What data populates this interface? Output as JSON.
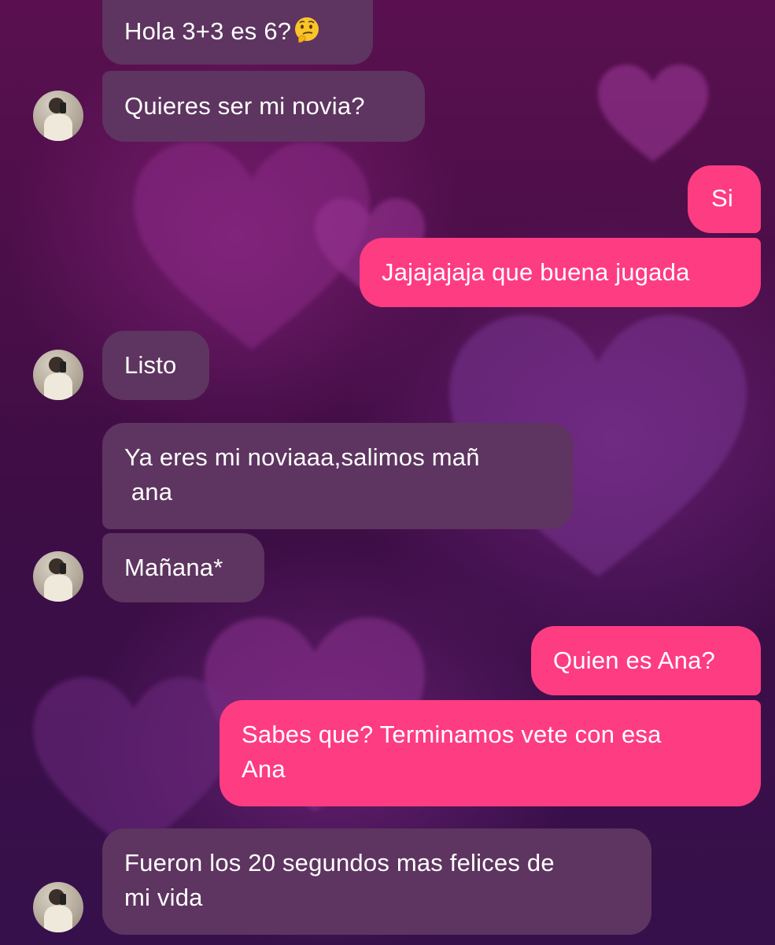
{
  "chat": {
    "messages": [
      {
        "id": 1,
        "from": "other",
        "text": "Hola 3+3 es 6?",
        "emoji": "thinking-face-icon"
      },
      {
        "id": 2,
        "from": "other",
        "text": "Quieres ser mi novia?"
      },
      {
        "id": 3,
        "from": "me",
        "text": "Si"
      },
      {
        "id": 4,
        "from": "me",
        "text": "Jajajajaja que buena jugada"
      },
      {
        "id": 5,
        "from": "other",
        "text": "Listo"
      },
      {
        "id": 6,
        "from": "other",
        "line1": "Ya eres mi noviaaa,salimos mañ",
        "line2": " ana"
      },
      {
        "id": 7,
        "from": "other",
        "text": "Mañana*"
      },
      {
        "id": 8,
        "from": "me",
        "text": "Quien es Ana?"
      },
      {
        "id": 9,
        "from": "me",
        "line1": "Sabes que? Terminamos vete con esa",
        "line2": "Ana"
      },
      {
        "id": 10,
        "from": "other",
        "line1": "Fueron los 20 segundos mas felices de",
        "line2": "mi vida"
      }
    ]
  },
  "colors": {
    "incoming_bubble": "#5e3460",
    "outgoing_bubble": "#fe3c82",
    "background": "#4a0e48",
    "text": "#ffffff"
  }
}
